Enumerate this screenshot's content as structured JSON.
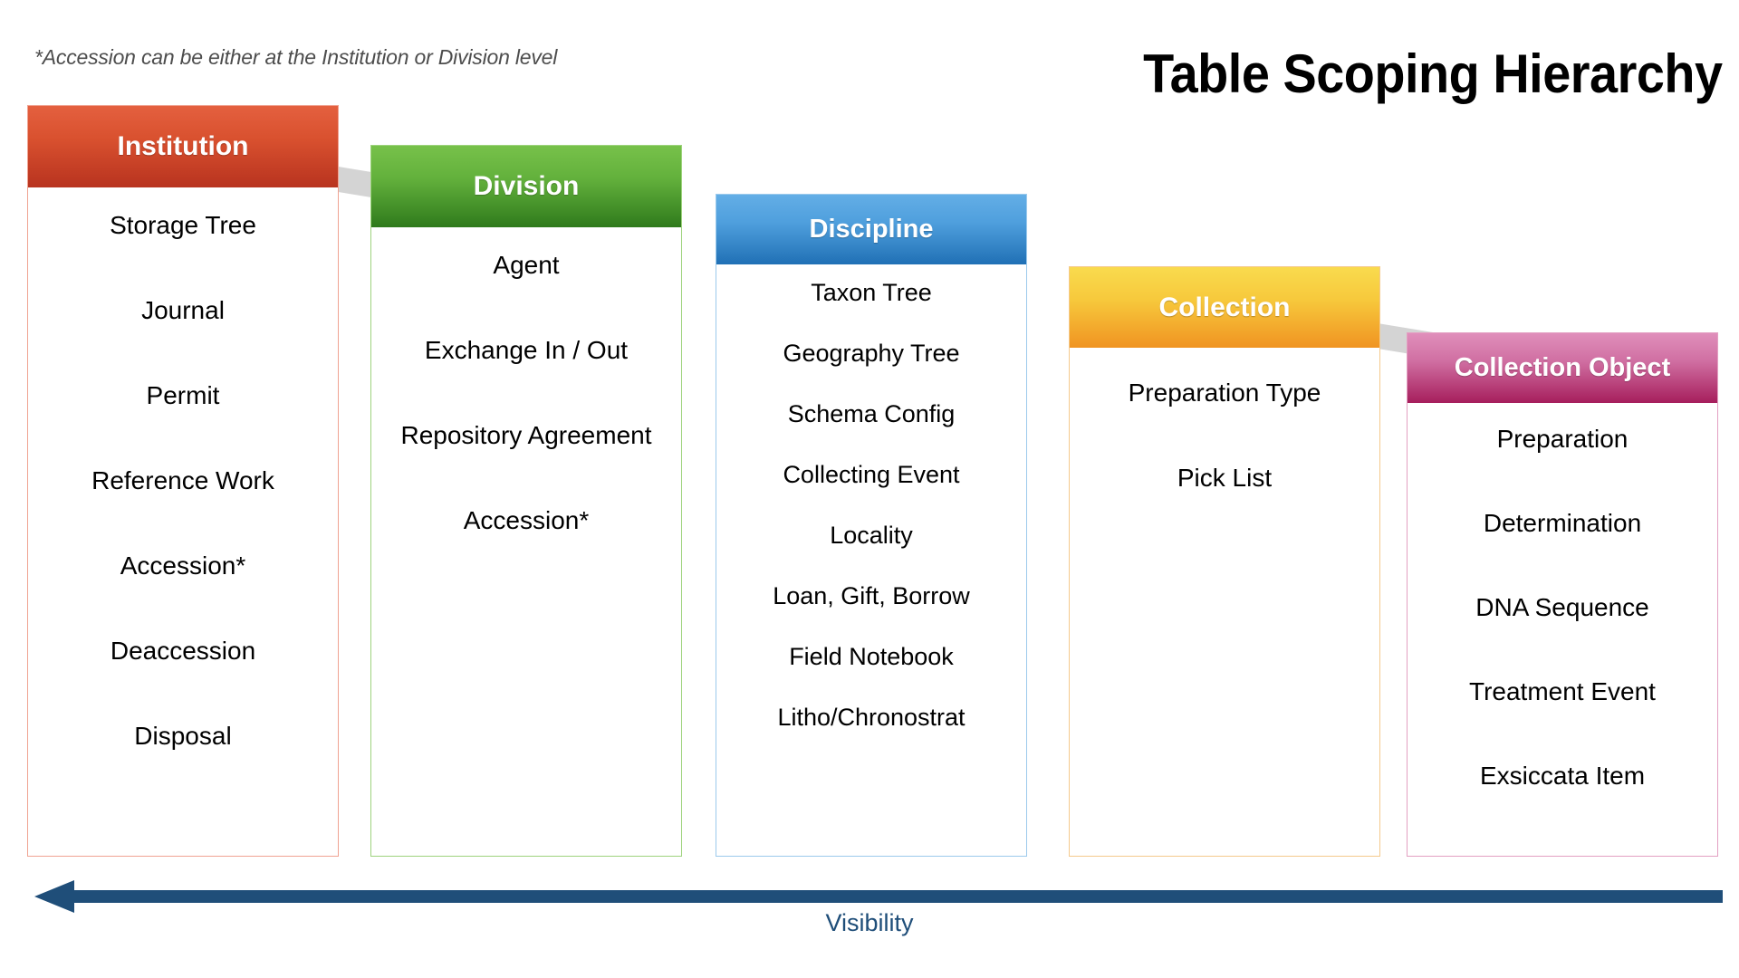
{
  "title": "Table Scoping Hierarchy",
  "footnote": "*Accession can be either at the Institution or Division level",
  "legend": {
    "visibility_label": "Visibility",
    "arrow_direction": "left",
    "arrow_color": "#1f4e79"
  },
  "columns": [
    {
      "id": "institution",
      "header": "Institution",
      "header_color": "#c8452a",
      "border_color": "#f0a392",
      "items": [
        "Storage Tree",
        "Journal",
        "Permit",
        "Reference Work",
        "Accession*",
        "Deaccession",
        "Disposal"
      ]
    },
    {
      "id": "division",
      "header": "Division",
      "header_color": "#4f9e32",
      "border_color": "#9ed37d",
      "items": [
        "Agent",
        "Exchange In / Out",
        "Repository Agreement",
        "Accession*"
      ]
    },
    {
      "id": "discipline",
      "header": "Discipline",
      "header_color": "#3a8fd0",
      "border_color": "#9ccaec",
      "items": [
        "Taxon Tree",
        "Geography Tree",
        "Schema Config",
        "Collecting Event",
        "Locality",
        "Loan, Gift, Borrow",
        "Field Notebook",
        "Litho/Chronostrat"
      ]
    },
    {
      "id": "collection",
      "header": "Collection",
      "header_color": "#f5bb35",
      "border_color": "#f5c98c",
      "items": [
        "Preparation Type",
        "Pick List"
      ]
    },
    {
      "id": "collectionobject",
      "header": "Collection Object",
      "header_color": "#b8317a",
      "border_color": "#e3a0c2",
      "items": [
        "Preparation",
        "Determination",
        "DNA Sequence",
        "Treatment Event",
        "Exsiccata Item"
      ]
    }
  ]
}
